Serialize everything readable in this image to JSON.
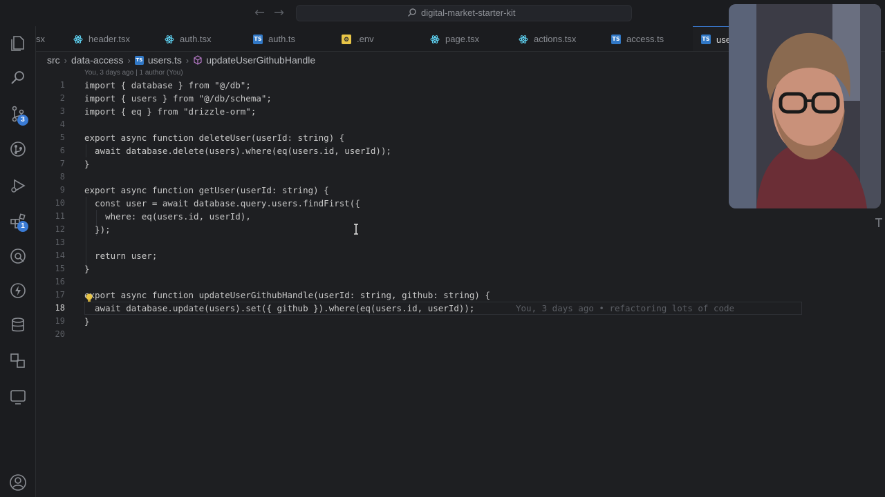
{
  "window": {
    "title": "digital-market-starter-kit"
  },
  "activity_badges": {
    "source_control": "3",
    "extensions": "1"
  },
  "tabs": [
    {
      "label": "sx",
      "icon": "ts"
    },
    {
      "label": "header.tsx",
      "icon": "react"
    },
    {
      "label": "auth.tsx",
      "icon": "react"
    },
    {
      "label": "auth.ts",
      "icon": "ts"
    },
    {
      "label": ".env",
      "icon": "env"
    },
    {
      "label": "page.tsx",
      "icon": "react"
    },
    {
      "label": "actions.tsx",
      "icon": "react"
    },
    {
      "label": "access.ts",
      "icon": "ts"
    },
    {
      "label": "use",
      "icon": "ts"
    }
  ],
  "breadcrumb": {
    "parts": [
      "src",
      "data-access",
      "users.ts",
      "updateUserGithubHandle"
    ]
  },
  "blame_header": "You, 3 days ago | 1 author (You)",
  "editor": {
    "current_line": "18",
    "line_numbers": [
      "1",
      "2",
      "3",
      "4",
      "5",
      "6",
      "7",
      "8",
      "9",
      "10",
      "11",
      "12",
      "13",
      "14",
      "15",
      "16",
      "17",
      "18",
      "19",
      "20"
    ],
    "lines": [
      "import { database } from \"@/db\";",
      "import { users } from \"@/db/schema\";",
      "import { eq } from \"drizzle-orm\";",
      "",
      "export async function deleteUser(userId: string) {",
      "  await database.delete(users).where(eq(users.id, userId));",
      "}",
      "",
      "export async function getUser(userId: string) {",
      "  const user = await database.query.users.findFirst({",
      "    where: eq(users.id, userId),",
      "  });",
      "",
      "  return user;",
      "}",
      "",
      "export async function updateUserGithubHandle(userId: string, github: string) {",
      "  await database.update(users).set({ github }).where(eq(users.id, userId));",
      "}",
      ""
    ],
    "inline_blame": "You, 3 days ago • refactoring lots of code"
  }
}
